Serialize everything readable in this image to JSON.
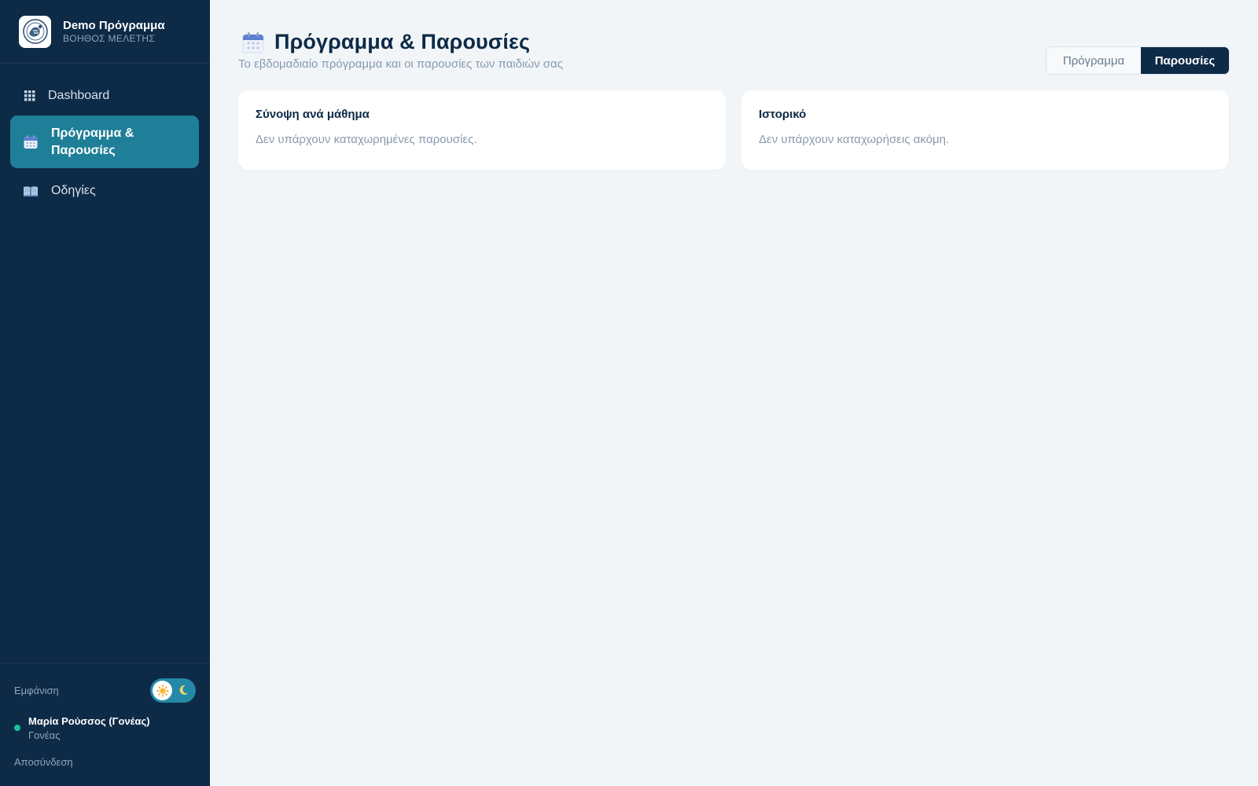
{
  "brand": {
    "name": "Demo Πρόγραμμα",
    "subtitle": "ΒΟΗΘΟΣ ΜΕΛΕΤΗΣ"
  },
  "sidebar": {
    "items": [
      {
        "label": "Dashboard",
        "icon": "grid-icon",
        "active": false
      },
      {
        "label": "Πρόγραμμα & Παρουσίες",
        "icon": "calendar-icon",
        "active": true
      },
      {
        "label": "Οδηγίες",
        "icon": "book-icon",
        "active": false
      }
    ],
    "appearance_label": "Εμφάνιση",
    "theme_mode": "light",
    "user": {
      "name": "Μαρία Ρούσσος (Γονέας)",
      "role": "Γονέας",
      "status": "online"
    },
    "logout_label": "Αποσύνδεση"
  },
  "header": {
    "title": "Πρόγραμμα & Παρουσίες",
    "subtitle": "Το εβδομαδιαίο πρόγραμμα και οι παρουσίες των παιδιών σας"
  },
  "tabs": [
    {
      "label": "Πρόγραμμα",
      "active": false
    },
    {
      "label": "Παρουσίες",
      "active": true
    }
  ],
  "cards": [
    {
      "title": "Σύνοψη ανά μάθημα",
      "text": "Δεν υπάρχουν καταχωρημένες παρουσίες."
    },
    {
      "title": "Ιστορικό",
      "text": "Δεν υπάρχουν καταχωρήσεις ακόμη."
    }
  ],
  "colors": {
    "sidebar_bg": "#0d2a47",
    "active_item": "#1f7f98",
    "page_bg": "#f1f5f8",
    "status_online": "#19c39a"
  }
}
